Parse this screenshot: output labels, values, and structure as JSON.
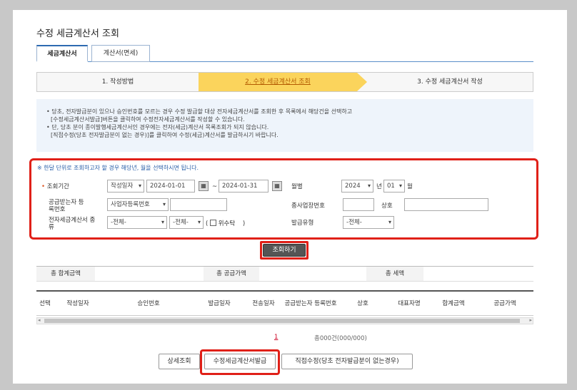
{
  "page_title": "수정 세금계산서 조회",
  "tabs": [
    {
      "label": "세금계산서"
    },
    {
      "label": "계산서(면세)"
    }
  ],
  "steps": [
    {
      "label": "1. 작성방법"
    },
    {
      "label": "2. 수정 세금계산서 조회"
    },
    {
      "label": "3. 수정 세금계산서 작성"
    }
  ],
  "info_lines": [
    "• 당초, 전자발급분이 있으나 승인번호를 모르는 경우 수정 발급할 대상 전자세금계산서를 조회한 후 목록에서 해당건을 선택하고",
    "[수정세금계산서발급]버튼을 클릭하여 수정전자세금계산서를 작성할 수 있습니다.",
    "• 단, 당초 분이 종이발행세금계산서인 경우에는 전자(세금)계산서 목록조회가 되지 않습니다.",
    "[직접수정(당초 전자발급분이 없는 경우)]를 클릭하여 수정(세금)계산서를 발급하시기 바랍니다."
  ],
  "search": {
    "note": "※ 한달 단위로 조회하고자 할 경우 해당년, 월을 선택하시면 됩니다.",
    "period_label": "조회기간",
    "period_type": "작성일자",
    "date_from": "2024-01-01",
    "tilde": "~",
    "date_to": "2024-01-31",
    "month_label": "월별",
    "year": "2024",
    "year_unit": "년",
    "month": "01",
    "month_unit": "월",
    "recipient_label": "공급받는자 등록번호",
    "recipient_type": "사업자등록번호",
    "branch_label": "종사업장번호",
    "company_label": "상호",
    "kind_label": "전자세금계산서 종류",
    "kind1": "-전체-",
    "kind2": "-전체-",
    "consign_label": "위수탁",
    "paren_open": "(",
    "paren_close": ")",
    "issue_type_label": "발급유형",
    "issue_type": "-전체-",
    "search_button": "조회하기"
  },
  "summary": {
    "total_sum_label": "총 합계금액",
    "total_supply_label": "총 공급가액",
    "total_tax_label": "총 세액"
  },
  "grid_headers": [
    "선택",
    "작성일자",
    "승인번호",
    "발급일자",
    "전송일자",
    "공급받는자 등록번호",
    "상호",
    "대표자명",
    "합계금액",
    "공급가액"
  ],
  "pagination": {
    "page": "1",
    "count": "총000건(000/000)"
  },
  "actions": {
    "detail": "상세조회",
    "modify_issue": "수정세금계산서발급",
    "direct_modify": "직접수정(당초 전자발급분이 없는경우)"
  },
  "colors": {
    "highlight": "#e02018",
    "step_active": "#fbd45c",
    "accent_blue": "#2d6ab1"
  }
}
